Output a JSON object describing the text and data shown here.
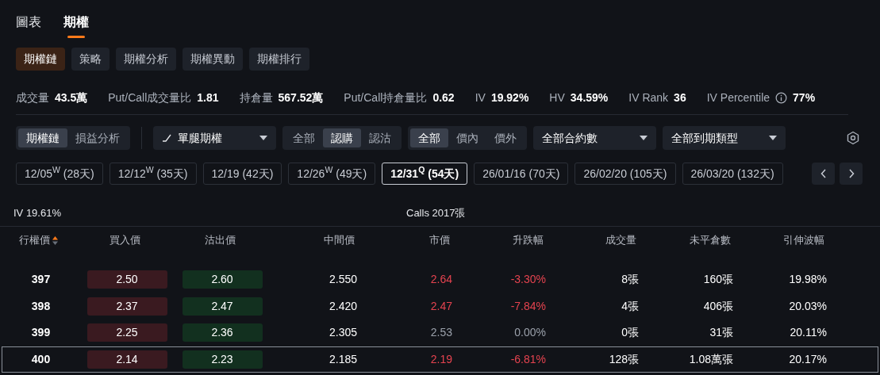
{
  "main_tabs": [
    {
      "label": "圖表",
      "selected": false
    },
    {
      "label": "期權",
      "selected": true
    }
  ],
  "sub_tabs": [
    {
      "label": "期權鏈",
      "selected": true
    },
    {
      "label": "策略",
      "selected": false
    },
    {
      "label": "期權分析",
      "selected": false
    },
    {
      "label": "期權異動",
      "selected": false
    },
    {
      "label": "期權排行",
      "selected": false
    }
  ],
  "stats": [
    {
      "label": "成交量",
      "value": "43.5萬",
      "info": false
    },
    {
      "label": "Put/Call成交量比",
      "value": "1.81",
      "info": false
    },
    {
      "label": "持倉量",
      "value": "567.52萬",
      "info": false
    },
    {
      "label": "Put/Call持倉量比",
      "value": "0.62",
      "info": false
    },
    {
      "label": "IV",
      "value": "19.92%",
      "info": false
    },
    {
      "label": "HV",
      "value": "34.59%",
      "info": false
    },
    {
      "label": "IV Rank",
      "value": "36",
      "info": false
    },
    {
      "label": "IV Percentile",
      "value": "77%",
      "info": true
    }
  ],
  "controls": [
    {
      "kind": "segmented",
      "options": [
        {
          "label": "期權鏈",
          "selected": true
        },
        {
          "label": "損益分析",
          "selected": false
        }
      ]
    },
    {
      "kind": "separator"
    },
    {
      "kind": "dropdown",
      "label": "單腿期權",
      "icon": true
    },
    {
      "kind": "segmented",
      "options": [
        {
          "label": "全部",
          "selected": false
        },
        {
          "label": "認購",
          "selected": true
        },
        {
          "label": "認沽",
          "selected": false
        }
      ]
    },
    {
      "kind": "segmented",
      "options": [
        {
          "label": "全部",
          "selected": true
        },
        {
          "label": "價內",
          "selected": false
        },
        {
          "label": "價外",
          "selected": false
        }
      ]
    },
    {
      "kind": "dropdown",
      "label": "全部合約數",
      "icon": false
    },
    {
      "kind": "dropdown",
      "label": "全部到期類型",
      "icon": false
    }
  ],
  "expiries": [
    {
      "label": "12/05$^{W}$ (28天)",
      "selected": false
    },
    {
      "label": "12/12$^{W}$ (35天)",
      "selected": false
    },
    {
      "label": "12/19 (42天)",
      "selected": false
    },
    {
      "label": "12/26$^{W}$ (49天)",
      "selected": false
    },
    {
      "label": "12/31$^{Q}$ (54天)",
      "selected": true
    },
    {
      "label": "26/01/16 (70天)",
      "selected": false
    },
    {
      "label": "26/02/20 (105天)",
      "selected": false
    },
    {
      "label": "26/03/20 (132天)",
      "selected": false
    }
  ],
  "table": {
    "iv": "IV 19.61%",
    "title": "Calls 2017張",
    "columns": [
      "行權價",
      "買入價",
      "沽出價",
      "中間價",
      "市價",
      "升跌幅",
      "成交量",
      "未平倉數",
      "引伸波幅"
    ],
    "rows": [
      {
        "strike": "397",
        "bid": "2.50",
        "ask": "2.60",
        "mid": "2.550",
        "last": "2.64",
        "change": "-3.30%",
        "color": "#e5434f",
        "volume": "8張",
        "open_interest": "160張",
        "iv": "19.98%",
        "selected": false
      },
      {
        "strike": "398",
        "bid": "2.37",
        "ask": "2.47",
        "mid": "2.420",
        "last": "2.47",
        "change": "-7.84%",
        "color": "#e5434f",
        "volume": "4張",
        "open_interest": "406張",
        "iv": "20.03%",
        "selected": false
      },
      {
        "strike": "399",
        "bid": "2.25",
        "ask": "2.36",
        "mid": "2.305",
        "last": "2.53",
        "change": "0.00%",
        "color": "#9aa0aa",
        "volume": "0張",
        "open_interest": "31張",
        "iv": "20.11%",
        "selected": false
      },
      {
        "strike": "400",
        "bid": "2.14",
        "ask": "2.23",
        "mid": "2.185",
        "last": "2.19",
        "change": "-6.81%",
        "color": "#e5434f",
        "volume": "128張",
        "open_interest": "1.08萬張",
        "iv": "20.17%",
        "selected": true
      }
    ]
  }
}
